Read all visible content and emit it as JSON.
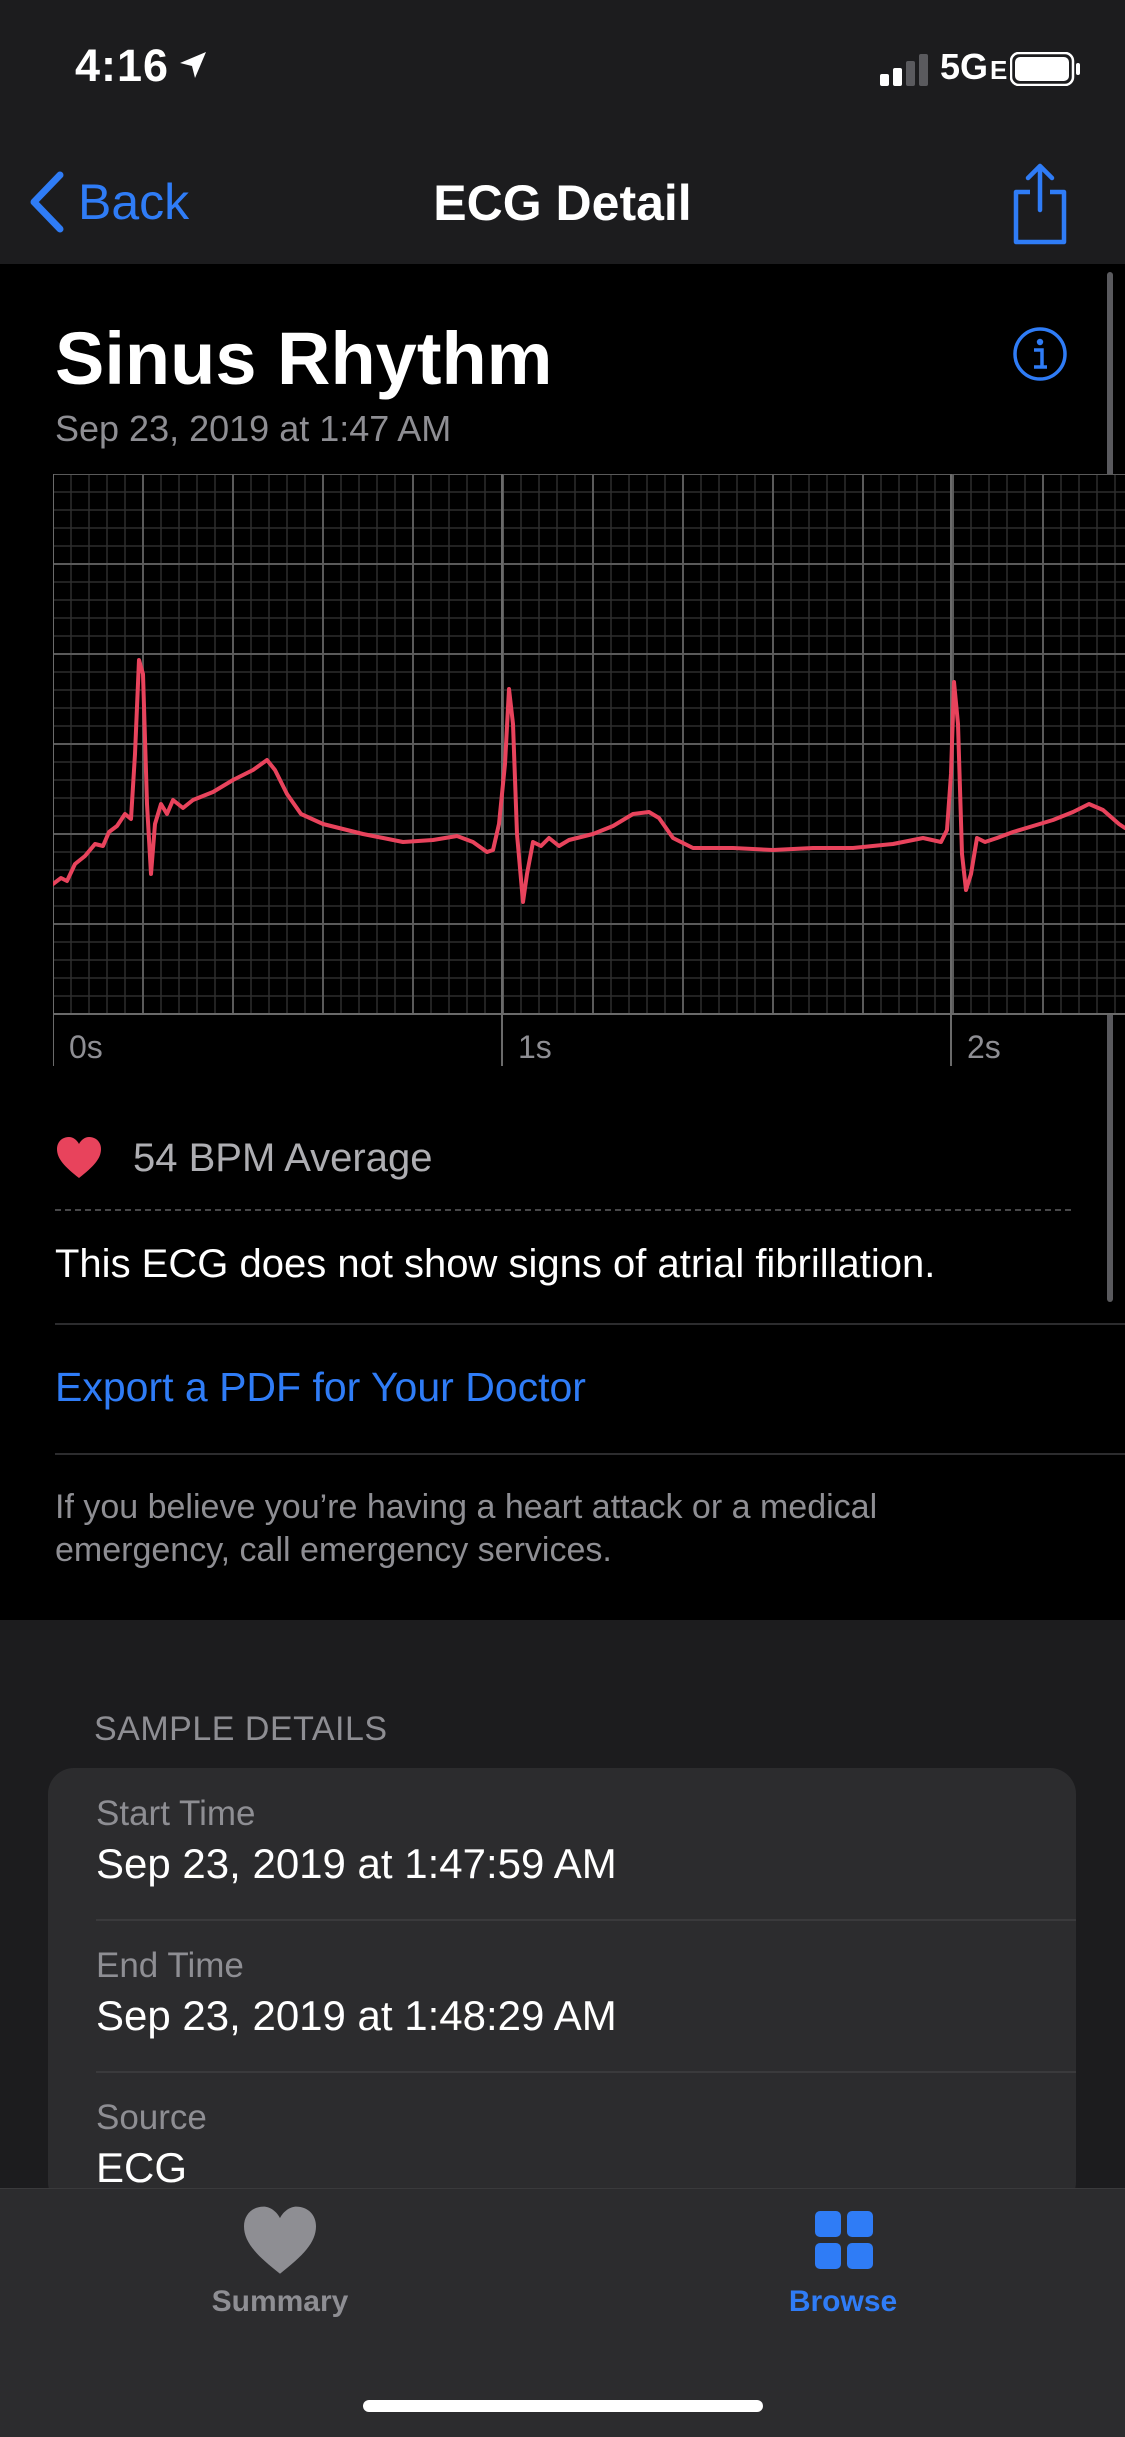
{
  "status_bar": {
    "time": "4:16",
    "network": "5G",
    "network_sub": "E"
  },
  "nav": {
    "back_label": "Back",
    "title": "ECG Detail"
  },
  "ecg": {
    "rhythm": "Sinus Rhythm",
    "date": "Sep 23, 2019 at 1:47 AM",
    "time_labels": [
      "0s",
      "1s",
      "2s"
    ],
    "waveform_color": "#e8435c"
  },
  "bpm": {
    "text": "54 BPM Average"
  },
  "result_text": "This ECG does not show signs of atrial fibrillation.",
  "export_label": "Export a PDF for Your Doctor",
  "warning_text": "If you believe you’re having a heart attack or a medical emergency, call emergency services.",
  "sample_details": {
    "header": "SAMPLE DETAILS",
    "rows": [
      {
        "label": "Start Time",
        "value": "Sep 23, 2019 at 1:47:59 AM"
      },
      {
        "label": "End Time",
        "value": "Sep 23, 2019 at 1:48:29 AM"
      },
      {
        "label": "Source",
        "value": "ECG"
      }
    ]
  },
  "tabs": [
    {
      "label": "Summary",
      "icon": "heart-icon",
      "active": false
    },
    {
      "label": "Browse",
      "icon": "grid-icon",
      "active": true
    }
  ],
  "colors": {
    "accent": "#2f7cf6",
    "ecg": "#e8435c",
    "inactive": "#8e8e93"
  }
}
